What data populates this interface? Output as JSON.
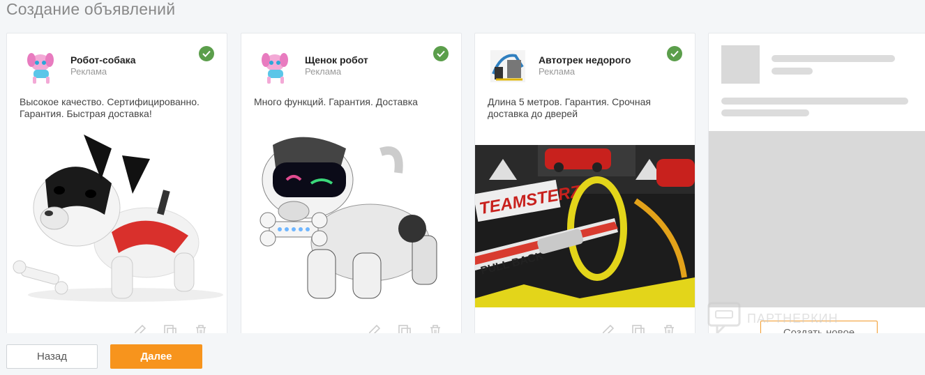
{
  "page": {
    "title": "Создание объявлений"
  },
  "cards": [
    {
      "title": "Робот-собака",
      "subtitle": "Реклама",
      "description": "Высокое качество. Сертифицированно. Гарантия. Быстрая доставка!",
      "status_icon": "check-icon",
      "image": "robot-dog-white-black-photo"
    },
    {
      "title": "Щенок робот",
      "subtitle": "Реклама",
      "description": "Много функций. Гарантия. Доставка",
      "status_icon": "check-icon",
      "image": "robot-puppy-silver-photo"
    },
    {
      "title": "Автотрек недорого",
      "subtitle": "Реклама",
      "description": "Длина 5 метров. Гарантия. Срочная доставка до дверей",
      "status_icon": "check-icon",
      "image": "toy-car-track-box-photo",
      "box_texts": {
        "brand": "TEAMSTERZ",
        "pull_back": "PULL BACK"
      }
    }
  ],
  "card_actions": [
    "edit-icon",
    "copy-icon",
    "trash-icon"
  ],
  "placeholder": {
    "create_label": "Создать новое"
  },
  "watermark": {
    "text": "ПАРТНЕРКИН"
  },
  "footer": {
    "back_label": "Назад",
    "next_label": "Далее"
  },
  "colors": {
    "accent": "#f7941d",
    "check": "#5b9e4b",
    "placeholder": "#d9d9d9"
  }
}
